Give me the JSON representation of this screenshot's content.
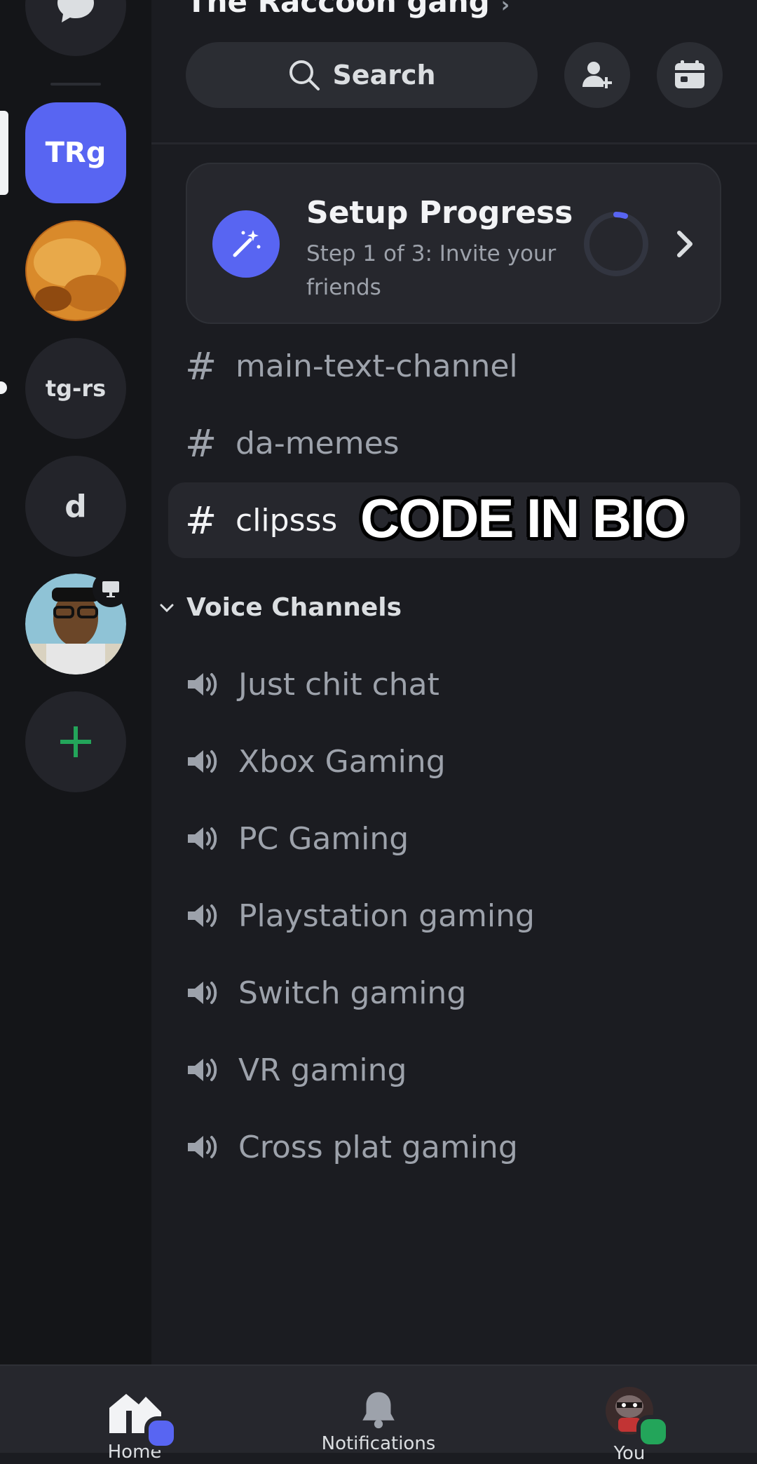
{
  "server": {
    "name": "The Raccoon gang"
  },
  "rail": {
    "servers": [
      {
        "label": "TRg",
        "active": true
      },
      {
        "label": "",
        "kind": "image"
      },
      {
        "label": "tg-rs"
      },
      {
        "label": "d"
      },
      {
        "label": "",
        "kind": "image"
      }
    ]
  },
  "header": {
    "search_label": "Search"
  },
  "setup": {
    "title": "Setup Progress",
    "subtitle": "Step 1 of 3: Invite your friends",
    "progress": 0.05
  },
  "channels": {
    "text": [
      "main-text-channel",
      "da-memes",
      "clipsss"
    ],
    "selected": "clipsss"
  },
  "overlay_text": "CODE IN BIO",
  "voice": {
    "category": "Voice Channels",
    "channels": [
      "Just chit chat",
      "Xbox Gaming",
      "PC Gaming",
      "Playstation gaming",
      "Switch gaming",
      "VR gaming",
      "Cross plat gaming"
    ]
  },
  "nav": {
    "home_label": "Home",
    "notifications_label": "Notifications",
    "you_label": "You"
  },
  "colors": {
    "accent": "#5865f2",
    "online": "#23a55a"
  }
}
